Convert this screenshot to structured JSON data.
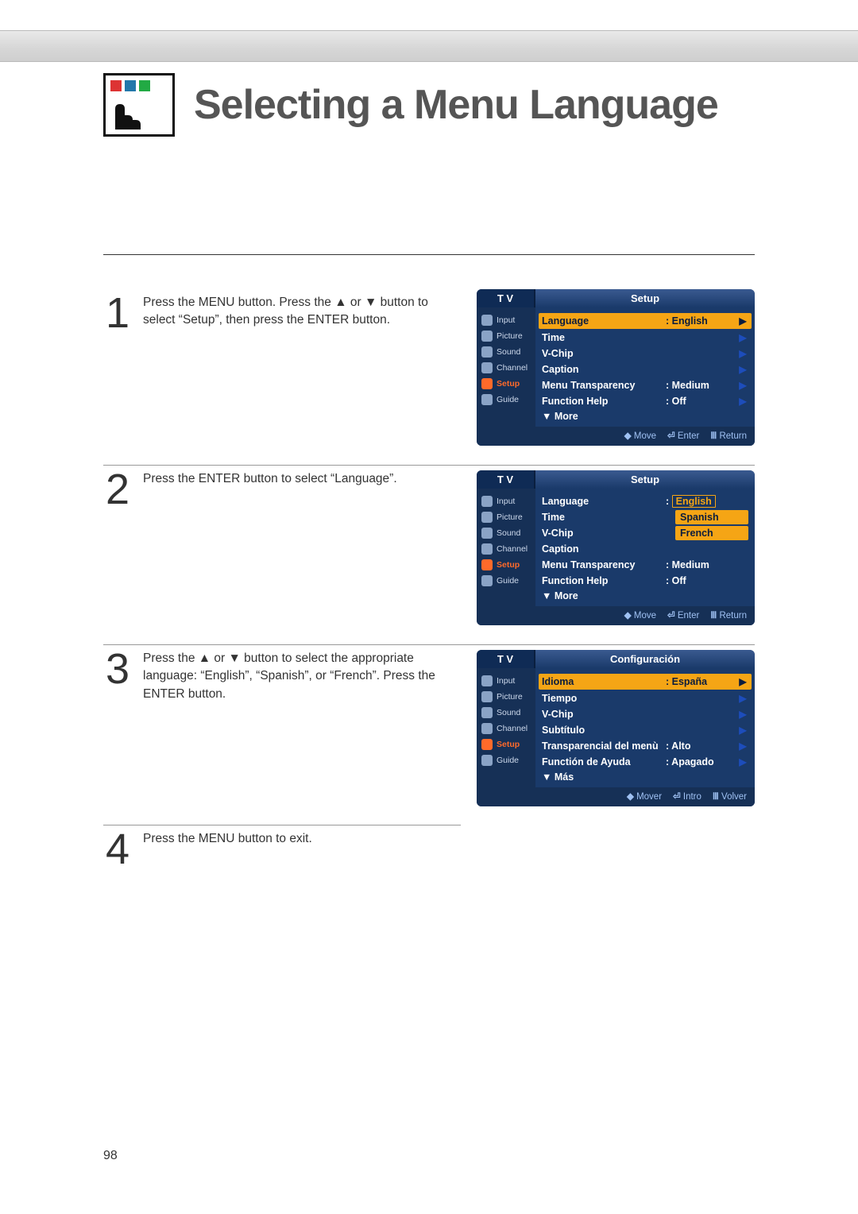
{
  "page": {
    "title": "Selecting a Menu Language",
    "pageNumber": "98"
  },
  "steps": {
    "s1": {
      "num": "1",
      "text": "Press the MENU button. Press the ▲ or ▼ button to select “Setup”, then press the ENTER button."
    },
    "s2": {
      "num": "2",
      "text": "Press the ENTER button to select “Language”."
    },
    "s3": {
      "num": "3",
      "text": "Press the ▲ or ▼ button to select the appropriate language: “English”, “Spanish”, or “French”. Press the ENTER button."
    },
    "s4": {
      "num": "4",
      "text": "Press the MENU button to exit."
    }
  },
  "osd": {
    "tv": "T V",
    "sidebar": [
      "Input",
      "Picture",
      "Sound",
      "Channel",
      "Setup",
      "Guide"
    ],
    "footer_en": {
      "move": "Move",
      "enter": "Enter",
      "return": "Return"
    },
    "footer_es": {
      "move": "Mover",
      "enter": "Intro",
      "return": "Volver"
    }
  },
  "panel1": {
    "title": "Setup",
    "rows": {
      "language": {
        "label": "Language",
        "value": ": English"
      },
      "time": {
        "label": "Time"
      },
      "vchip": {
        "label": "V-Chip"
      },
      "caption": {
        "label": "Caption"
      },
      "transparency": {
        "label": "Menu Transparency",
        "value": ": Medium"
      },
      "help": {
        "label": "Function Help",
        "value": ": Off"
      },
      "more": "▼ More"
    }
  },
  "panel2": {
    "title": "Setup",
    "rows": {
      "language": {
        "label": "Language",
        "value": "English"
      },
      "time": {
        "label": "Time"
      },
      "vchip": {
        "label": "V-Chip"
      },
      "caption": {
        "label": "Caption"
      },
      "transparency": {
        "label": "Menu Transparency",
        "value": ": Medium"
      },
      "help": {
        "label": "Function Help",
        "value": ": Off"
      },
      "more": "▼ More",
      "opt_spanish": "Spanish",
      "opt_french": "French"
    }
  },
  "panel3": {
    "title": "Configuración",
    "rows": {
      "language": {
        "label": "Idioma",
        "value": ": España"
      },
      "time": {
        "label": "Tiempo"
      },
      "vchip": {
        "label": "V-Chip"
      },
      "caption": {
        "label": "Subtítulo"
      },
      "transparency": {
        "label": "Transparencial del menù",
        "value": ": Alto"
      },
      "help": {
        "label": "Functión de Ayuda",
        "value": ": Apagado"
      },
      "more": "▼ Más"
    }
  }
}
